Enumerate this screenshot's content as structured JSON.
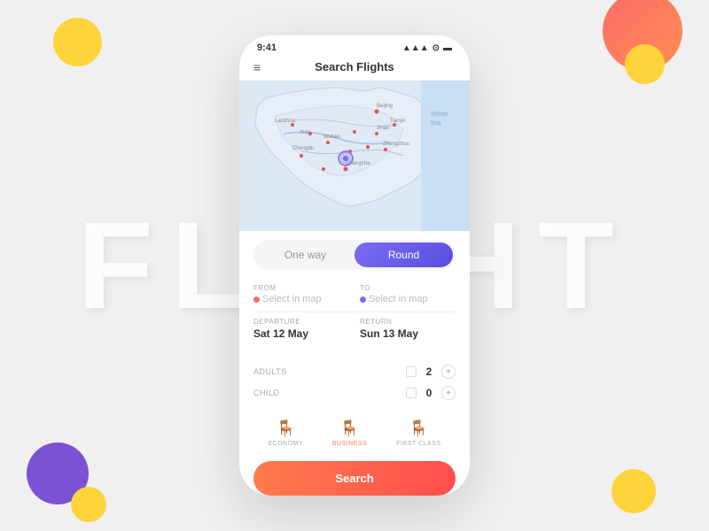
{
  "background": {
    "text": "FLIGHT"
  },
  "status_bar": {
    "time": "9:41",
    "signal": "▲▲▲",
    "wifi": "◈",
    "battery": "▮▮▮"
  },
  "header": {
    "menu_icon": "≡",
    "title": "Search Flights"
  },
  "toggle": {
    "one_way": "One way",
    "round": "Round"
  },
  "form": {
    "from_label": "FROM",
    "from_placeholder": "Select in map",
    "to_label": "TO",
    "to_placeholder": "Select in map",
    "departure_label": "DEPARTURE",
    "departure_value": "Sat 12 May",
    "return_label": "RETURN",
    "return_value": "Sun 13 May"
  },
  "passengers": {
    "adults_label": "ADULTS",
    "adults_count": "2",
    "child_label": "CHILD",
    "child_count": "0"
  },
  "classes": [
    {
      "id": "economy",
      "label": "ECONOMY",
      "active": false
    },
    {
      "id": "business",
      "label": "BUSINESS",
      "active": true
    },
    {
      "id": "first",
      "label": "FIRST CLASS",
      "active": false
    }
  ],
  "search_button": {
    "label": "Search"
  }
}
